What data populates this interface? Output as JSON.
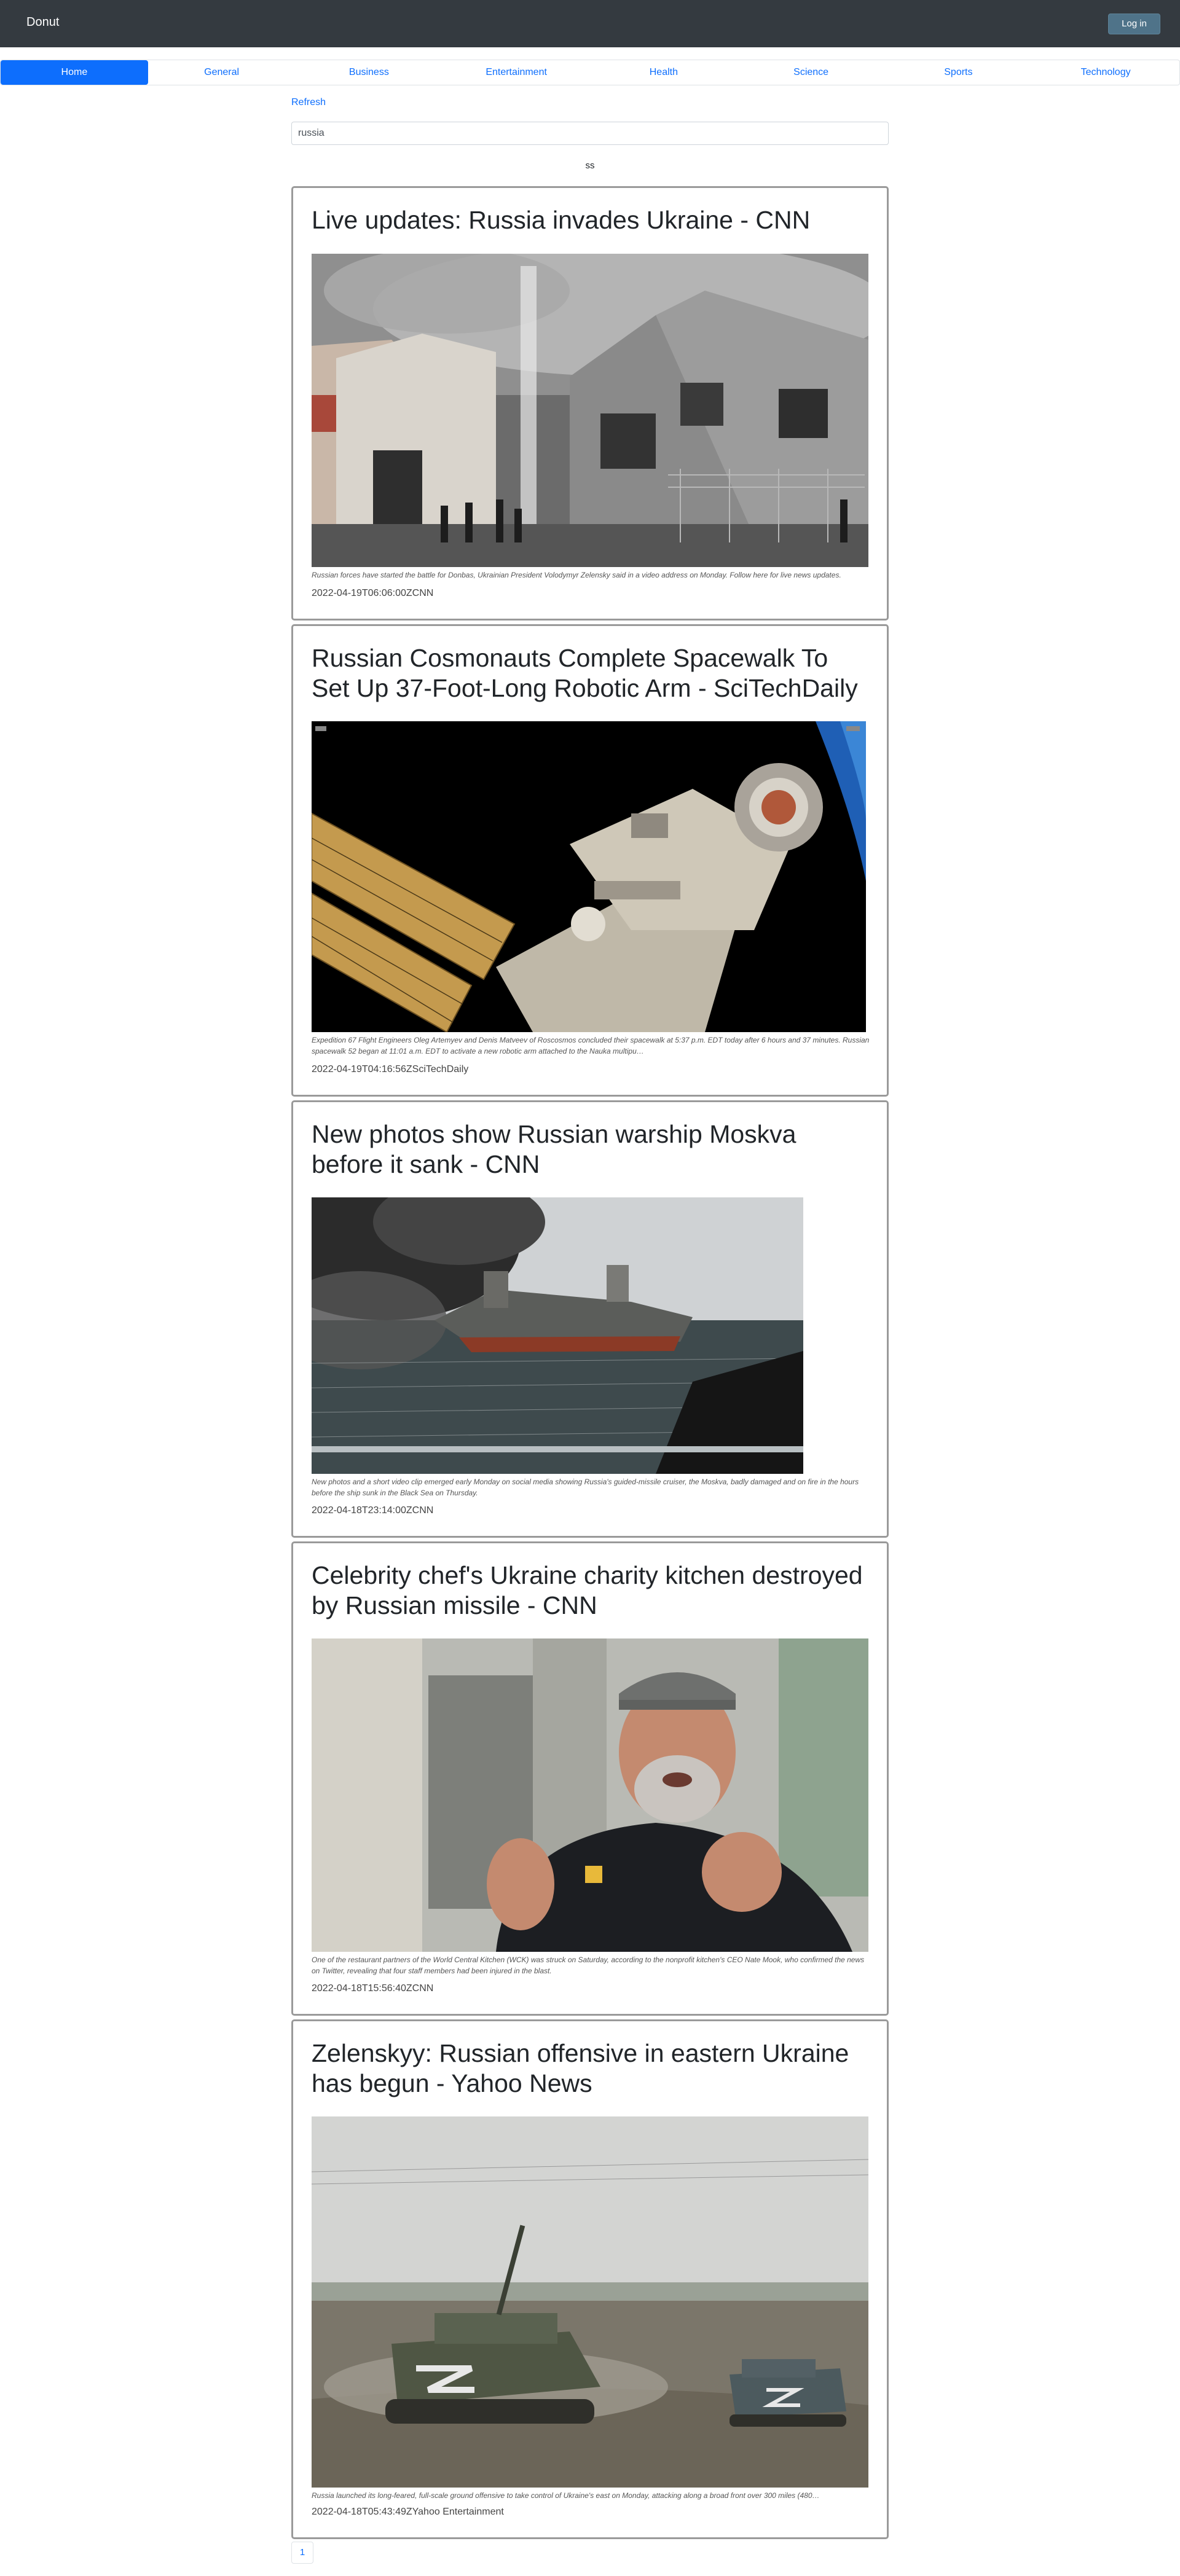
{
  "app": {
    "brand": "Donut",
    "login_label": "Log in"
  },
  "nav": {
    "items": [
      {
        "label": "Home"
      },
      {
        "label": "General"
      },
      {
        "label": "Business"
      },
      {
        "label": "Entertainment"
      },
      {
        "label": "Health"
      },
      {
        "label": "Science"
      },
      {
        "label": "Sports"
      },
      {
        "label": "Technology"
      }
    ],
    "active": "Home"
  },
  "toolbar": {
    "refresh_label": "Refresh"
  },
  "search": {
    "value": "russia"
  },
  "status": {
    "text": "ss"
  },
  "articles": [
    {
      "title": "Live updates: Russia invades Ukraine - CNN",
      "image": "burning-house-photo",
      "caption": "Russian forces have started the battle for Donbas, Ukrainian President Volodymyr Zelensky said in a video address on Monday. Follow here for live news updates.",
      "meta": "2022-04-19T06:06:00ZCNN"
    },
    {
      "title": "Russian Cosmonauts Complete Spacewalk To Set Up 37-Foot-Long Robotic Arm - SciTechDaily",
      "image": "space-station-photo",
      "caption": "Expedition 67 Flight Engineers Oleg Artemyev and Denis Matveev of Roscosmos concluded their spacewalk at 5:37 p.m. EDT today after 6 hours and 37 minutes. Russian spacewalk 52 began at 11:01 a.m. EDT to activate a new robotic arm attached to the Nauka multipu…",
      "meta": "2022-04-19T04:16:56ZSciTechDaily"
    },
    {
      "title": "New photos show Russian warship Moskva before it sank - CNN",
      "image": "warship-smoke-photo",
      "caption": "New photos and a short video clip emerged early Monday on social media showing Russia's guided-missile cruiser, the Moskva, badly damaged and on fire in the hours before the ship sunk in the Black Sea on Thursday.",
      "meta": "2022-04-18T23:14:00ZCNN"
    },
    {
      "title": "Celebrity chef's Ukraine charity kitchen destroyed by Russian missile - CNN",
      "image": "chef-portrait-photo",
      "caption": "One of the restaurant partners of the World Central Kitchen (WCK) was struck on Saturday, according to the nonprofit kitchen's CEO Nate Mook, who confirmed the news on Twitter, revealing that four staff members had been injured in the blast.",
      "meta": "2022-04-18T15:56:40ZCNN"
    },
    {
      "title": "Zelenskyy: Russian offensive in eastern Ukraine has begun - Yahoo News",
      "image": "armored-vehicles-photo",
      "caption": "Russia launched its long-feared, full-scale ground offensive to take control of Ukraine's east on Monday, attacking along a broad front over 300 miles (480…",
      "meta": "2022-04-18T05:43:49ZYahoo Entertainment"
    }
  ],
  "pagination": {
    "current": "1"
  },
  "colors": {
    "accent": "#0d6efd",
    "topbar": "#343a40",
    "login": "#4f7389"
  }
}
